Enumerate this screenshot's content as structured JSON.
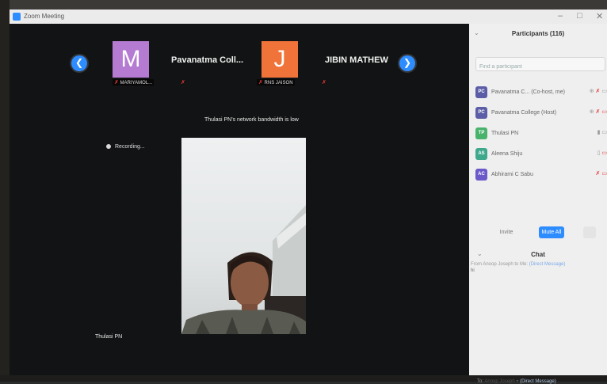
{
  "window": {
    "title": "Zoom Meeting"
  },
  "gallery": {
    "tiles": [
      {
        "initial": "M",
        "label": "MARIYAMOL...",
        "color": "#b57bd2"
      },
      {
        "name": "Pavanatma Coll..."
      },
      {
        "initial": "J",
        "label": "RNS JAISON",
        "color": "#f0743a"
      },
      {
        "name": "JIBIN MATHEW"
      }
    ]
  },
  "notice": {
    "bandwidth": "Thulasi PN's network bandwidth is low"
  },
  "recording": {
    "label": "Recording..."
  },
  "speaker": {
    "name": "Thulasi PN"
  },
  "participants_panel": {
    "title": "Participants (116)",
    "search_placeholder": "Find a participant",
    "list": [
      {
        "initials": "PC",
        "name": "Pavanatma C... (Co-host, me)",
        "color": "#5b5ea6"
      },
      {
        "initials": "PC",
        "name": "Pavanatma College (Host)",
        "color": "#5b5ea6"
      },
      {
        "initials": "TP",
        "name": "Thulasi PN",
        "color": "#49b36c"
      },
      {
        "initials": "AS",
        "name": "Aleena Shiju",
        "color": "#3fa88c"
      },
      {
        "initials": "AC",
        "name": "Abhirami C Sabu",
        "color": "#6b58c9"
      }
    ],
    "invite_label": "Invite",
    "mute_all_label": "Mute All"
  },
  "chat": {
    "title": "Chat",
    "message_header": "From Anoop Joseph to Me:",
    "message_tag": "(Direct Message)",
    "message_body": "hi",
    "to_label": "To:",
    "recipient": "Anoop Joseph",
    "direct_tag": "(Direct Message)"
  },
  "colors": {
    "accent": "#2d8cff",
    "muted_red": "#e53935",
    "panel_bg": "#efefef",
    "video_bg": "#121314"
  }
}
